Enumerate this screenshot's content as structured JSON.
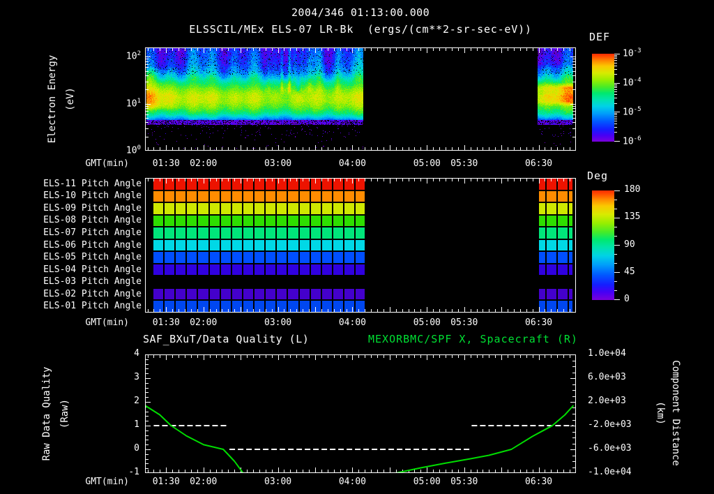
{
  "colors": {
    "background": "#000000",
    "frame": "#ffffff",
    "text": "#ffffff",
    "title_right_green": "#00e033",
    "orbit_line": "#00dd00",
    "quality_line": "#ffffff"
  },
  "header": {
    "title": "2004/346 01:13:00.000",
    "subtitle": "ELSSCIL/MEx ELS-07 LR-Bk  (ergs/(cm**2-sr-sec-eV))"
  },
  "x_axis": {
    "label": "GMT(min)",
    "start_min": 73,
    "end_min": 420,
    "minor_tick_min": 5,
    "major_tick_min": 30,
    "ticks": [
      {
        "t": 90,
        "label": "01:30"
      },
      {
        "t": 120,
        "label": "02:00"
      },
      {
        "t": 180,
        "label": "03:00"
      },
      {
        "t": 240,
        "label": "04:00"
      },
      {
        "t": 300,
        "label": "05:00"
      },
      {
        "t": 330,
        "label": "05:30"
      },
      {
        "t": 390,
        "label": "06:30"
      }
    ]
  },
  "chart_data": [
    {
      "id": "electron-energy-spectrogram",
      "type": "heatmap",
      "ylabel": "Electron Energy",
      "ylabel_units": "(eV)",
      "yscale": "log",
      "ylim_ev": [
        1,
        158
      ],
      "ytick_exponents": [
        "0",
        "1",
        "2"
      ],
      "colorbar": {
        "title": "DEF",
        "scale": "log",
        "tick_exponents": [
          "-3",
          "-4",
          "-5",
          "-6"
        ],
        "min": "1e-6",
        "max": "1e-3"
      },
      "data_blocks_min": [
        [
          74,
          249
        ],
        [
          389,
          417.5
        ]
      ],
      "spectral_profile_logE_value": [
        [
          0.54,
          0.0
        ],
        [
          0.62,
          0.22
        ],
        [
          0.7,
          0.4
        ],
        [
          0.8,
          0.56
        ],
        [
          0.92,
          0.66
        ],
        [
          1.05,
          0.73
        ],
        [
          1.18,
          0.74
        ],
        [
          1.32,
          0.66
        ],
        [
          1.45,
          0.56
        ],
        [
          1.58,
          0.44
        ],
        [
          1.7,
          0.33
        ],
        [
          1.85,
          0.27
        ],
        [
          2.0,
          0.24
        ],
        [
          2.2,
          0.21
        ]
      ],
      "streaks": [
        {
          "t": 172,
          "w": 3,
          "amp": 0.07
        },
        {
          "t": 183,
          "w": 2,
          "amp": 0.18
        },
        {
          "t": 186,
          "w": 3,
          "amp": 0.1
        },
        {
          "t": 189,
          "w": 2,
          "amp": 0.22
        },
        {
          "t": 196,
          "w": 3,
          "amp": -0.12
        },
        {
          "t": 205,
          "w": 4,
          "amp": 0.1
        },
        {
          "t": 214,
          "w": 4,
          "amp": 0.08
        },
        {
          "t": 228,
          "w": 3,
          "amp": 0.07
        }
      ],
      "left_edge_boost": 0.14,
      "right_block_boost": 0.12,
      "noise_amp": 0.09
    },
    {
      "id": "pitch-angle-panel",
      "type": "heatmap",
      "rows": [
        {
          "label": "ELS-11 Pitch Angle",
          "deg": 178,
          "color": "#ed1300"
        },
        {
          "label": "ELS-10 Pitch Angle",
          "deg": 152,
          "color": "#ff8c00"
        },
        {
          "label": "ELS-09 Pitch Angle",
          "deg": 130,
          "color": "#cfe800"
        },
        {
          "label": "ELS-08 Pitch Angle",
          "deg": 108,
          "color": "#2ede00"
        },
        {
          "label": "ELS-07 Pitch Angle",
          "deg": 88,
          "color": "#00e67a"
        },
        {
          "label": "ELS-06 Pitch Angle",
          "deg": 68,
          "color": "#00d8e6"
        },
        {
          "label": "ELS-05 Pitch Angle",
          "deg": 42,
          "color": "#004fff"
        },
        {
          "label": "ELS-04 Pitch Angle",
          "deg": 20,
          "color": "#3000e0"
        },
        {
          "label": "ELS-03 Pitch Angle",
          "deg": null,
          "color": null
        },
        {
          "label": "ELS-02 Pitch Angle",
          "deg": 14,
          "color": "#4400cc"
        },
        {
          "label": "ELS-01 Pitch Angle",
          "deg": 40,
          "color": "#0047f0"
        }
      ],
      "data_blocks_min": [
        [
          79,
          250
        ],
        [
          390,
          417
        ]
      ],
      "cell_width_min": 9.05,
      "colorbar": {
        "title": "Deg",
        "ticks": [
          180,
          135,
          90,
          45,
          0
        ],
        "range": [
          0,
          180
        ]
      }
    },
    {
      "id": "quality-and-distance",
      "type": "line",
      "title_left": "SAF_BXuT/Data Quality (L)",
      "title_right": "MEXORBMC/SPF X, Spacecraft (R)",
      "ylabel_left": "Raw Data Quality",
      "ylabel_left_units": "(Raw)",
      "ylim_left": [
        -1,
        4
      ],
      "yticks_left": [
        4,
        3,
        2,
        1,
        0,
        -1
      ],
      "ylabel_right": "Component Distance",
      "ylabel_right_units": "(km)",
      "ylim_right": [
        -10000,
        10000
      ],
      "yticks_right": [
        "1.0e+04",
        "6.0e+03",
        "2.0e+03",
        "-2.0e+03",
        "-6.0e+03",
        "-1.0e+04"
      ],
      "series": [
        {
          "name": "data-quality",
          "axis": "left",
          "style": "dashed",
          "color": "#ffffff",
          "segments": [
            {
              "t0": 80,
              "t1": 140,
              "value": 1
            },
            {
              "t0": 141,
              "t1": 335,
              "value": 0
            },
            {
              "t0": 336,
              "t1": 418,
              "value": 1
            }
          ]
        },
        {
          "name": "spacecraft-x-component",
          "axis": "left",
          "style": "solid",
          "color": "#00dd00",
          "polylines": [
            [
              [
                73,
                1.85
              ],
              [
                85,
                1.45
              ],
              [
                94,
                1.0
              ],
              [
                106,
                0.58
              ],
              [
                120,
                0.2
              ],
              [
                136,
                0.0
              ],
              [
                145,
                -0.5
              ],
              [
                152,
                -1.0
              ]
            ],
            [
              [
                275,
                -1.0
              ],
              [
                295,
                -0.78
              ],
              [
                315,
                -0.58
              ],
              [
                335,
                -0.4
              ],
              [
                350,
                -0.25
              ],
              [
                368,
                0.0
              ],
              [
                385,
                0.55
              ],
              [
                401,
                1.0
              ],
              [
                411,
                1.45
              ],
              [
                418,
                1.85
              ]
            ]
          ]
        }
      ]
    }
  ]
}
